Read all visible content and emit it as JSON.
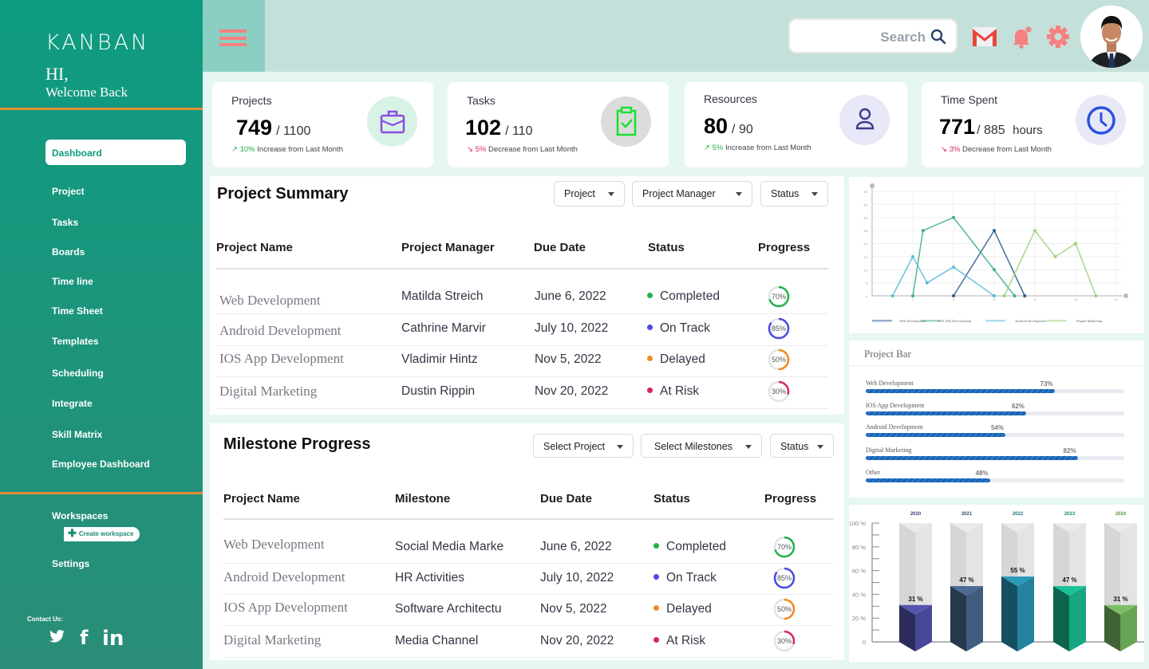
{
  "sidebar": {
    "logo": "KANBAN",
    "greeting": "HI,",
    "welcome": "Welcome Back",
    "active_item": "Dashboard",
    "items": [
      "Project",
      "Tasks",
      "Boards",
      "Time line",
      "Time Sheet",
      "Templates",
      "Scheduling",
      "Integrate",
      "Skill Matrix",
      "Employee Dashboard"
    ],
    "workspaces_label": "Workspaces",
    "create_workspace": "Create workspace",
    "settings_label": "Settings",
    "contact_label": "Contact Us:",
    "social": {
      "twitter": "twitter-icon",
      "facebook": "f",
      "linkedin": "in"
    }
  },
  "topbar": {
    "search_placeholder": "Search",
    "icons": [
      "menu-icon",
      "gmail-icon",
      "bell-icon",
      "gear-icon",
      "avatar"
    ],
    "accent_color": "#f78080"
  },
  "stats": [
    {
      "title": "Projects",
      "value": "749",
      "total": "/ 1100",
      "unit": "",
      "trend_pct": "10%",
      "trend_text": "Increase from Last Month",
      "trend": "up",
      "icon": "briefcase-icon"
    },
    {
      "title": "Tasks",
      "value": "102",
      "total": "/ 110",
      "unit": "",
      "trend_pct": "5%",
      "trend_text": "Decrease from Last Month",
      "trend": "down",
      "icon": "clipboard-check-icon"
    },
    {
      "title": "Resources",
      "value": "80",
      "total": "/ 90",
      "unit": "",
      "trend_pct": "5%",
      "trend_text": "Increase from Last Month",
      "trend": "up",
      "icon": "user-icon"
    },
    {
      "title": "Time Spent",
      "value": "771",
      "total": "/ 885",
      "unit": "hours",
      "trend_pct": "3%",
      "trend_text": "Decrease from Last Month",
      "trend": "down",
      "icon": "clock-icon"
    }
  ],
  "project_summary": {
    "title": "Project Summary",
    "filters": [
      "Project",
      "Project Manager",
      "Status"
    ],
    "columns": [
      "Project Name",
      "Project Manager",
      "Due Date",
      "Status",
      "Progress"
    ],
    "rows": [
      {
        "name": "Web Development",
        "manager": "Matilda Streich",
        "due": "June 6, 2022",
        "status": "Completed",
        "status_color": "#22b14c",
        "progress": 70
      },
      {
        "name": "Android Development",
        "manager": "Cathrine Marvir",
        "due": "July 10, 2022",
        "status": "On Track",
        "status_color": "#4a4ae0",
        "progress": 85
      },
      {
        "name": "IOS App Development",
        "manager": "Vladimir Hintz",
        "due": "Nov 5, 2022",
        "status": "Delayed",
        "status_color": "#f08a1c",
        "progress": 50
      },
      {
        "name": "Digital Marketing",
        "manager": "Dustin Rippin",
        "due": "Nov 20, 2022",
        "status": "At Risk",
        "status_color": "#d6285b",
        "progress": 30
      }
    ]
  },
  "milestone_progress": {
    "title": "Milestone Progress",
    "filters": [
      "Select Project",
      "Select Milestones",
      "Status"
    ],
    "columns": [
      "Project Name",
      "Milestone",
      "Due Date",
      "Status",
      "Progress"
    ],
    "rows": [
      {
        "name": "Web Development",
        "milestone": "Social Media Marke",
        "due": "June 6, 2022",
        "status": "Completed",
        "status_color": "#22b14c",
        "progress": 70
      },
      {
        "name": "Android Development",
        "milestone": "HR Activities",
        "due": "July 10, 2022",
        "status": "On Track",
        "status_color": "#4a4ae0",
        "progress": 85
      },
      {
        "name": "IOS App Development",
        "milestone": "Software Architectu",
        "due": "Nov 5, 2022",
        "status": "Delayed",
        "status_color": "#f08a1c",
        "progress": 50
      },
      {
        "name": "Digital Marketing",
        "milestone": "Media Channel",
        "due": "Nov 20, 2022",
        "status": "At Risk",
        "status_color": "#d6285b",
        "progress": 30
      }
    ]
  },
  "chart_data": [
    {
      "type": "line",
      "title": "",
      "xlabel": "",
      "ylabel": "",
      "xlim": [
        0,
        12
      ],
      "ylim": [
        0,
        40
      ],
      "grid": true,
      "legend": "bottom",
      "series": [
        {
          "name": "Web Development",
          "color": "#2c5d93",
          "points": [
            [
              4,
              0
            ],
            [
              6,
              25
            ],
            [
              7.5,
              0
            ]
          ]
        },
        {
          "name": "IOS APp Development",
          "color": "#3fae8e",
          "points": [
            [
              2,
              0
            ],
            [
              2.5,
              25
            ],
            [
              4,
              30
            ],
            [
              6,
              10
            ],
            [
              7,
              0
            ]
          ]
        },
        {
          "name": "Android development",
          "color": "#59bcd9",
          "points": [
            [
              1,
              0
            ],
            [
              2,
              15
            ],
            [
              2.7,
              5
            ],
            [
              4,
              11
            ],
            [
              6,
              0
            ]
          ]
        },
        {
          "name": "Digital Marketing",
          "color": "#9cd27e",
          "points": [
            [
              6.5,
              0
            ],
            [
              8,
              25
            ],
            [
              9,
              15
            ],
            [
              10,
              20
            ],
            [
              11,
              0
            ]
          ]
        }
      ]
    },
    {
      "type": "bar",
      "orientation": "horizontal",
      "title": "Project Bar",
      "categories": [
        "Web Development",
        "IOS App Development",
        "Android Development",
        "Digital Marketing",
        "Other"
      ],
      "values": [
        73,
        62,
        54,
        82,
        48
      ],
      "value_labels": [
        "73%",
        "62%",
        "54%",
        "82%",
        "48%"
      ],
      "xlim": [
        0,
        100
      ]
    },
    {
      "type": "bar",
      "title": "",
      "categories": [
        "2020",
        "2021",
        "2022",
        "2023",
        "2024"
      ],
      "values": [
        31,
        47,
        55,
        47,
        31
      ],
      "value_labels": [
        "31 %",
        "47 %",
        "55 %",
        "47 %",
        "31 %"
      ],
      "colors": [
        "#3e3f82",
        "#38506e",
        "#1e7289",
        "#139070",
        "#5b8e4b"
      ],
      "ylim": [
        0,
        100
      ],
      "yticks": [
        "0",
        "20 %",
        "40 %",
        "60 %",
        "80 %",
        "100 %"
      ]
    }
  ]
}
